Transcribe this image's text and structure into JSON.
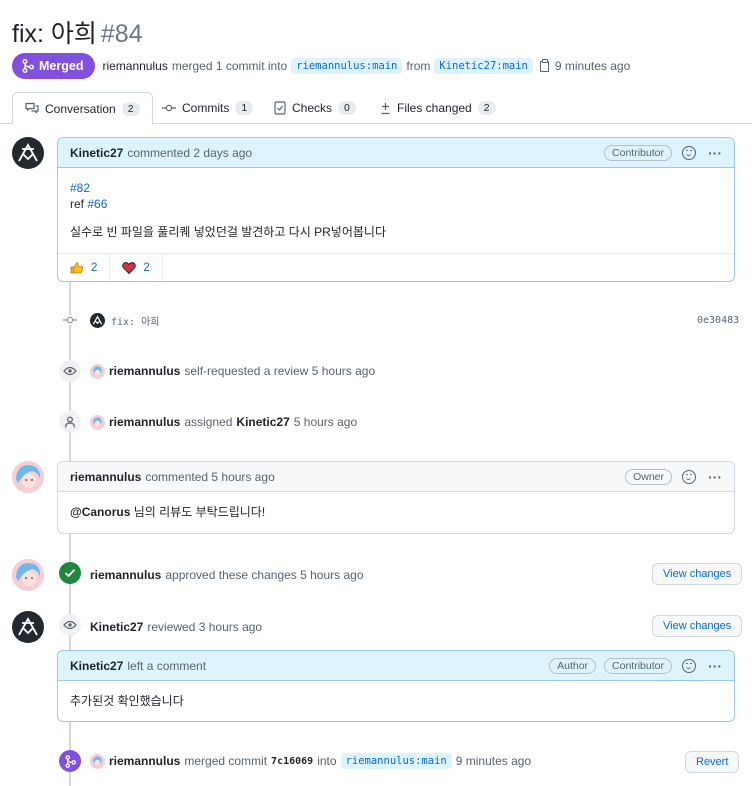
{
  "pr": {
    "title": "fix: 아희",
    "number": "#84",
    "status": "Merged",
    "author": "riemannulus",
    "merge_text": "merged 1 commit into",
    "base_branch": "riemannulus:main",
    "from_text": "from",
    "head_branch": "Kinetic27:main",
    "time": "9 minutes ago"
  },
  "tabs": [
    {
      "label": "Conversation",
      "count": "2"
    },
    {
      "label": "Commits",
      "count": "1"
    },
    {
      "label": "Checks",
      "count": "0"
    },
    {
      "label": "Files changed",
      "count": "2"
    }
  ],
  "comment1": {
    "author": "Kinetic27",
    "action": "commented 2 days ago",
    "role": "Contributor",
    "line1_link": "#82",
    "line2_prefix": "ref",
    "line2_link": "#66",
    "text": "실수로 빈 파일을 풀리퀘 넣었던걸 발견하고 다시 PR넣어봅니다",
    "thumbs_count": "2",
    "heart_count": "2"
  },
  "commit_event": {
    "message": "fix: 아희",
    "sha": "0e30483"
  },
  "review_request_event": {
    "user": "riemannulus",
    "text": "self-requested a review 5 hours ago"
  },
  "assign_event": {
    "user": "riemannulus",
    "text_before": "assigned",
    "target": "Kinetic27",
    "text_after": "5 hours ago"
  },
  "comment2": {
    "author": "riemannulus",
    "action": "commented 5 hours ago",
    "role": "Owner",
    "mention": "@Canorus",
    "text": "님의 리뷰도 부탁드립니다!"
  },
  "approve_event": {
    "user": "riemannulus",
    "text": "approved these changes 5 hours ago",
    "button": "View changes"
  },
  "review_event": {
    "user": "Kinetic27",
    "text": "reviewed 3 hours ago",
    "button": "View changes"
  },
  "comment3": {
    "author": "Kinetic27",
    "action": "left a comment",
    "role1": "Author",
    "role2": "Contributor",
    "text": "추가된것 확인했습니다"
  },
  "merge_event": {
    "user": "riemannulus",
    "text1": "merged commit",
    "sha": "7c16069",
    "text2": "into",
    "branch": "riemannulus:main",
    "time": "9 minutes ago",
    "button": "Revert"
  },
  "colors": {
    "merged": "#8250df",
    "approved": "#1f883d",
    "link": "#0969da"
  }
}
